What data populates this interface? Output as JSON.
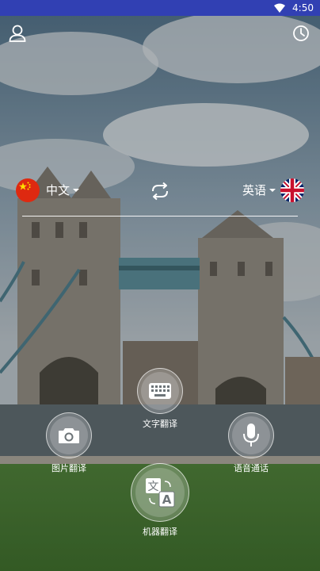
{
  "status_bar": {
    "time": "4:50"
  },
  "language_bar": {
    "source_language": "中文",
    "target_language": "英语"
  },
  "actions": {
    "text_translate": "文字翻译",
    "photo_translate": "图片翻译",
    "voice_call": "语音通话",
    "machine_translate": "机器翻译"
  },
  "machine_icon_glyphs": {
    "top": "文",
    "bottom": "A"
  },
  "colors": {
    "status_bar": "#3140b3",
    "text": "#ffffff"
  }
}
